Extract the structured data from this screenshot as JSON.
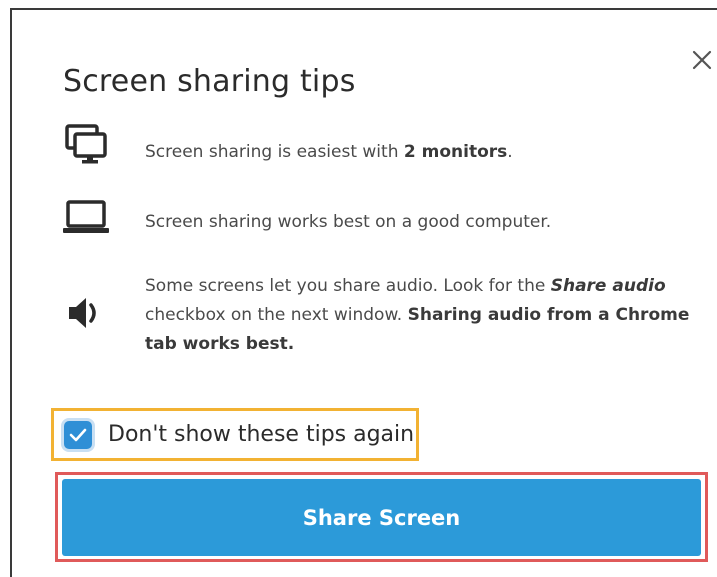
{
  "dialog": {
    "title": "Screen sharing tips",
    "close_icon": "close-icon"
  },
  "tips": [
    {
      "icon": "dual-monitor-icon",
      "text_before": "Screen sharing is easiest with ",
      "bold": "2 monitors",
      "text_after": "."
    },
    {
      "icon": "laptop-icon",
      "text": "Screen sharing works best on a good computer."
    },
    {
      "icon": "speaker-icon",
      "text_before": "Some screens let you share audio. Look for the ",
      "bold_italic": "Share audio",
      "text_middle": " checkbox on the next window. ",
      "bold": "Sharing audio from a Chrome tab works best."
    }
  ],
  "checkbox": {
    "label": "Don't show these tips again",
    "checked": true
  },
  "share_button": {
    "label": "Share Screen"
  },
  "colors": {
    "primary_button": "#2c9ad9",
    "checkbox": "#2f8fd6",
    "checkbox_highlight": "#f2b233",
    "button_highlight": "#e05a5a"
  }
}
